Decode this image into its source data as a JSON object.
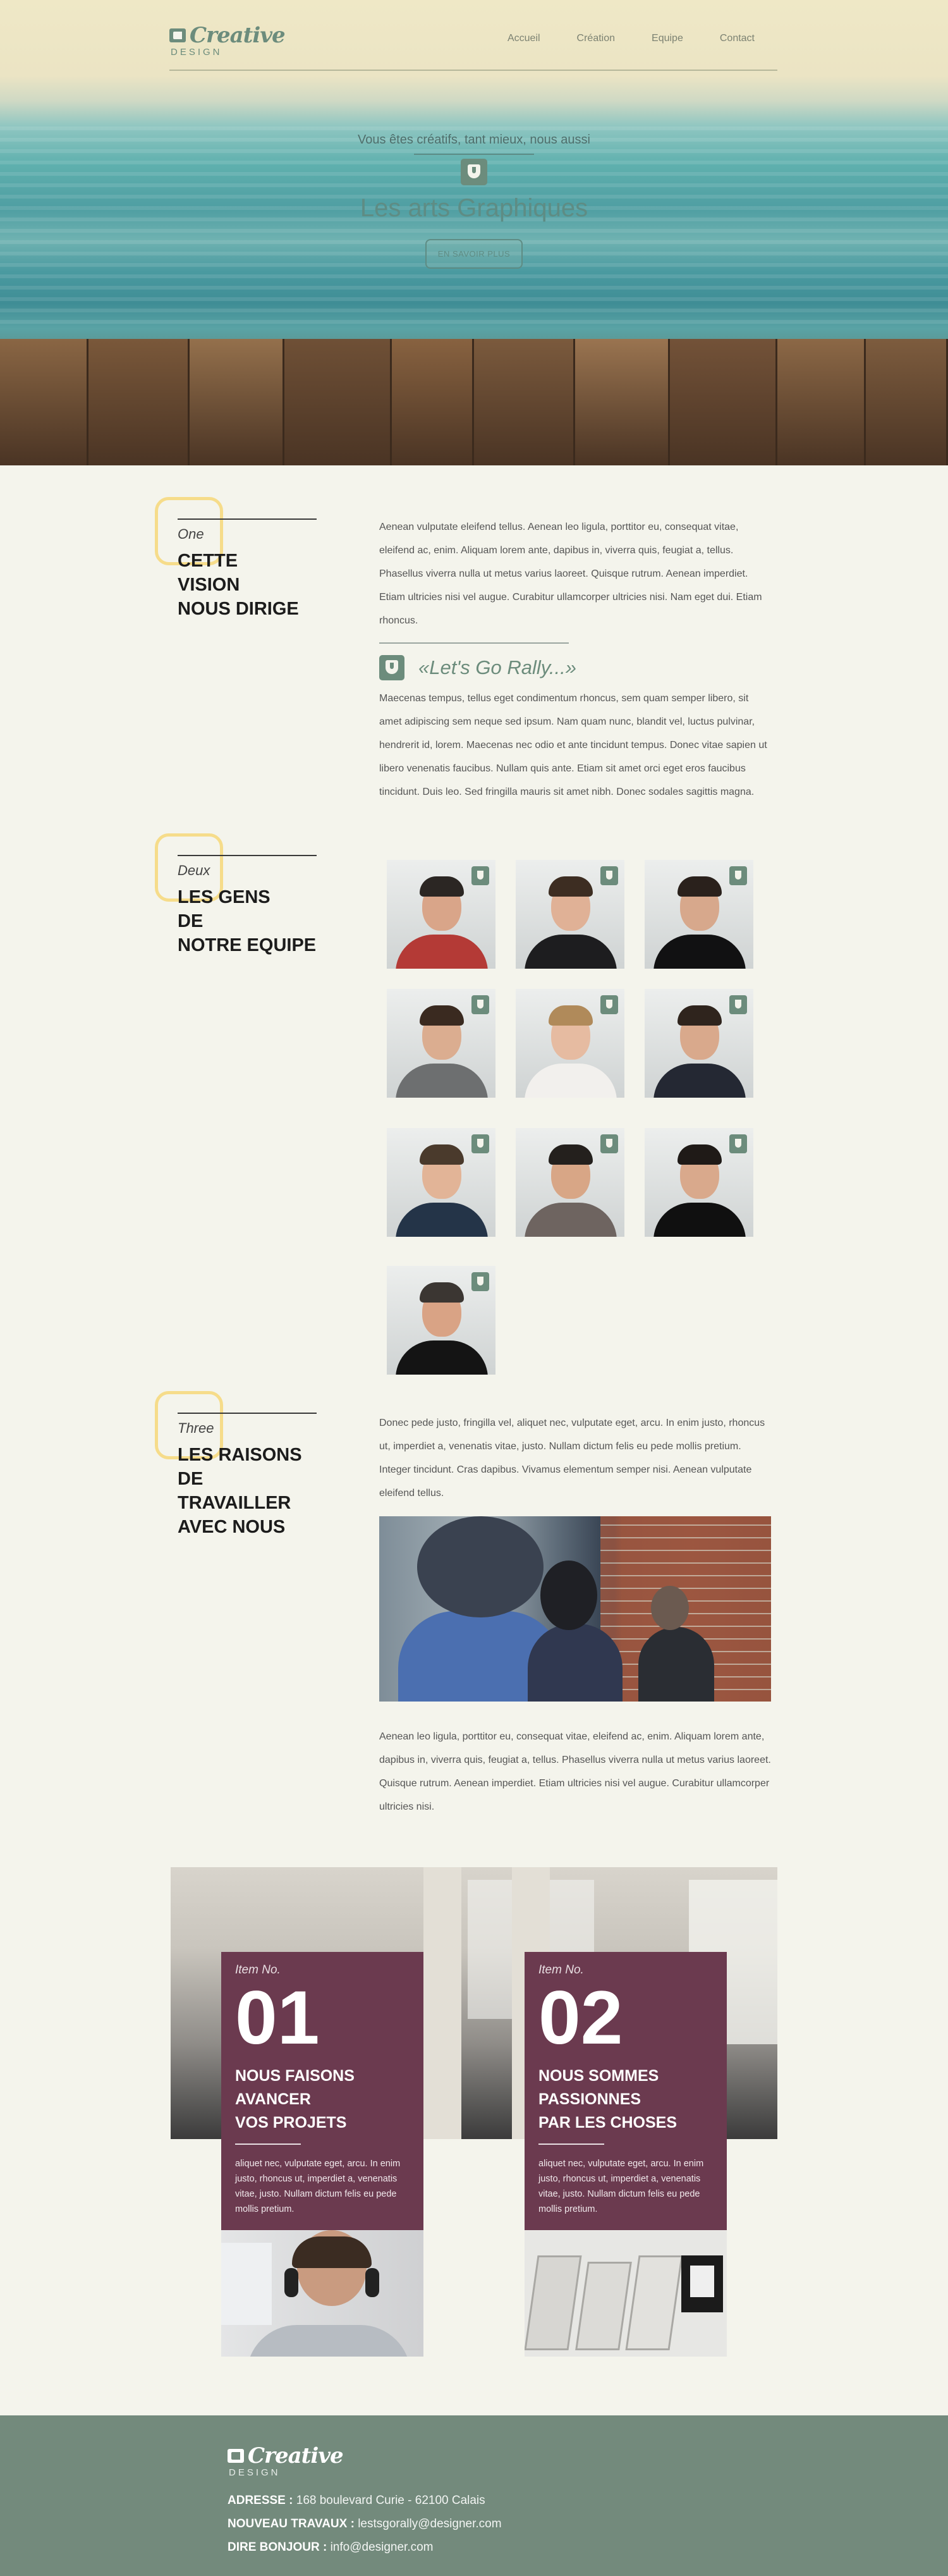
{
  "header": {
    "logo_word": "Creative",
    "logo_sub": "DESIGN",
    "nav": [
      "Accueil",
      "Création",
      "Equipe",
      "Contact"
    ]
  },
  "hero": {
    "tagline": "Vous êtes créatifs, tant mieux, nous aussi",
    "title": "Les arts Graphiques",
    "cta": "EN SAVOIR PLUS"
  },
  "section1": {
    "num": "One",
    "title_lines": [
      "CETTE",
      "VISION",
      "NOUS DIRIGE"
    ],
    "p1": "Aenean vulputate eleifend tellus. Aenean leo ligula, porttitor eu, consequat vitae, eleifend ac, enim. Aliquam lorem ante, dapibus in, viverra quis, feugiat a, tellus. Phasellus viverra nulla ut metus varius laoreet. Quisque rutrum. Aenean imperdiet. Etiam ultricies nisi vel augue. Curabitur ullamcorper ultricies nisi. Nam eget dui. Etiam rhoncus.",
    "quote": "«Let's Go Rally...»",
    "p2": "Maecenas tempus, tellus eget condimentum rhoncus, sem quam semper libero, sit amet adipiscing sem neque sed ipsum. Nam quam nunc, blandit vel, luctus pulvinar, hendrerit id, lorem. Maecenas nec odio et ante tincidunt tempus. Donec vitae sapien ut libero venenatis faucibus. Nullam quis ante. Etiam sit amet orci eget eros faucibus tincidunt. Duis leo. Sed fringilla mauris sit amet nibh. Donec sodales sagittis magna."
  },
  "section2": {
    "num": "Deux",
    "title_lines": [
      "LES GENS",
      "DE",
      "NOTRE EQUIPE"
    ],
    "team": [
      {
        "hair": "#2b2623",
        "shirt": "#b43a36",
        "skin": "#d9a589"
      },
      {
        "hair": "#3d2d22",
        "shirt": "#1d1d1f",
        "skin": "#e0b196"
      },
      {
        "hair": "#2a211c",
        "shirt": "#111112",
        "skin": "#d7a88c"
      },
      {
        "hair": "#3a2a20",
        "shirt": "#6d6f70",
        "skin": "#dbad90"
      },
      {
        "hair": "#b08a5a",
        "shirt": "#f2f0ed",
        "skin": "#e6bba1"
      },
      {
        "hair": "#2f241d",
        "shirt": "#242833",
        "skin": "#d9a98c"
      },
      {
        "hair": "#4a3a2c",
        "shirt": "#243448",
        "skin": "#e2b497"
      },
      {
        "hair": "#24201d",
        "shirt": "#6e6460",
        "skin": "#d8a686"
      },
      {
        "hair": "#1f1a17",
        "shirt": "#101010",
        "skin": "#d9a98c"
      },
      {
        "hair": "#3b3632",
        "shirt": "#141414",
        "skin": "#d9a385"
      }
    ]
  },
  "section3": {
    "num": "Three",
    "title_lines": [
      "LES RAISONS",
      "DE TRAVAILLER",
      "AVEC NOUS"
    ],
    "p1": "Donec pede justo, fringilla vel, aliquet nec, vulputate eget, arcu. In enim justo, rhoncus ut, imperdiet a, venenatis vitae, justo. Nullam dictum felis eu pede mollis pretium. Integer tincidunt. Cras dapibus. Vivamus elementum semper nisi. Aenean vulputate eleifend tellus.",
    "p2": "Aenean leo ligula, porttitor eu, consequat vitae, eleifend ac, enim. Aliquam lorem ante, dapibus in, viverra quis, feugiat a, tellus. Phasellus viverra nulla ut metus varius laoreet. Quisque rutrum. Aenean imperdiet. Etiam ultricies nisi vel augue. Curabitur ullamcorper ultricies nisi."
  },
  "items": [
    {
      "label": "Item No.",
      "number": "01",
      "title_lines": [
        "NOUS FAISONS",
        "AVANCER",
        "VOS PROJETS"
      ],
      "text": "aliquet nec, vulputate eget, arcu. In enim justo, rhoncus ut, imperdiet a, venenatis vitae, justo. Nullam dictum felis eu pede mollis pretium."
    },
    {
      "label": "Item No.",
      "number": "02",
      "title_lines": [
        "NOUS SOMMES",
        "PASSIONNES",
        "PAR LES CHOSES"
      ],
      "text": "aliquet nec, vulputate eget, arcu. In enim justo, rhoncus ut, imperdiet a, venenatis vitae, justo. Nullam dictum felis eu pede mollis pretium."
    }
  ],
  "footer": {
    "logo_word": "Creative",
    "logo_sub": "DESIGN",
    "address_label": "ADRESSE :",
    "address": "168 boulevard Curie - 62100 Calais",
    "jobs_label": "NOUVEAU TRAVAUX :",
    "jobs": "lestsgorally@designer.com",
    "hello_label": "DIRE BONJOUR :",
    "hello": "info@designer.com"
  },
  "colors": {
    "accent": "#6c8c7c",
    "card": "#6b3a4f",
    "footer": "#738a7c",
    "deco": "#f6dc8a",
    "background": "#f4f4ec"
  }
}
